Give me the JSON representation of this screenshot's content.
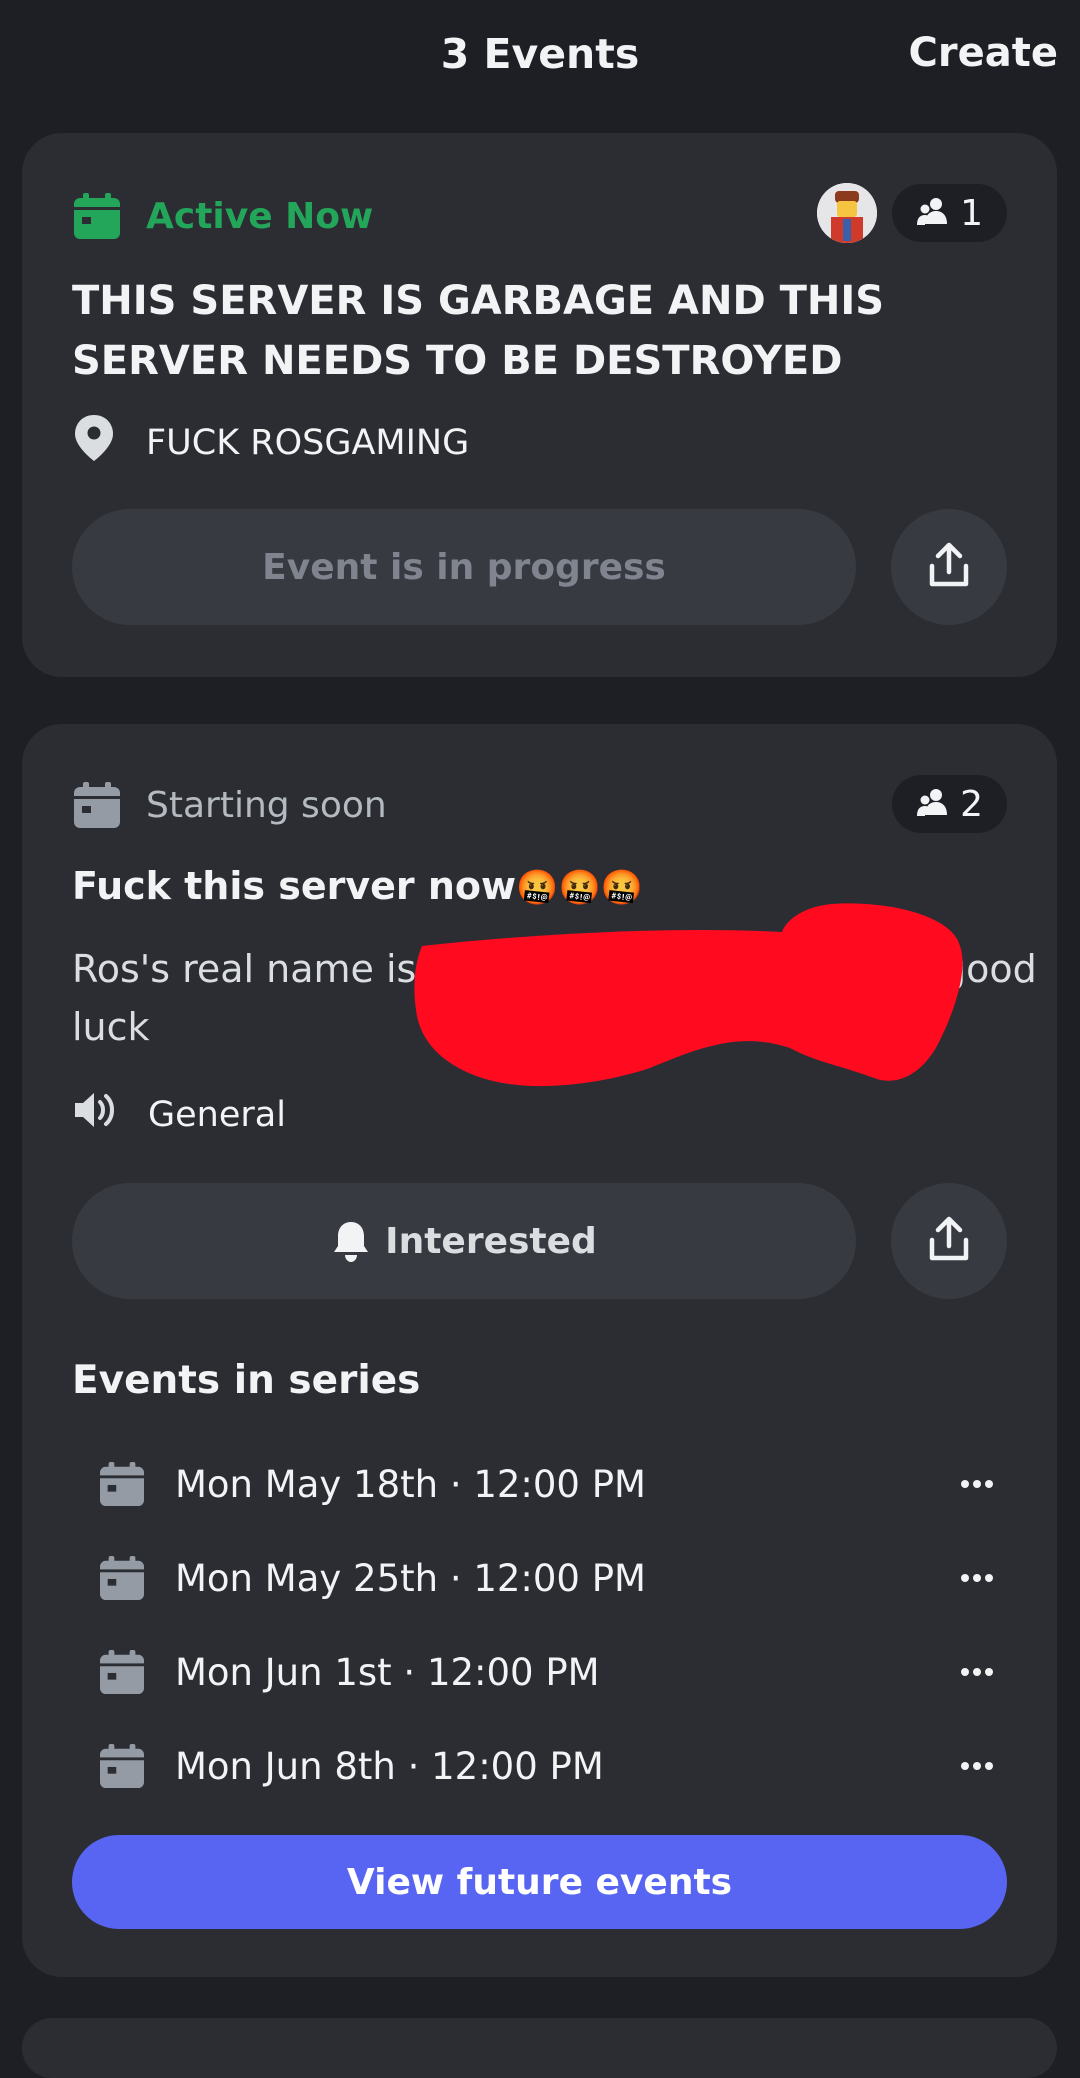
{
  "header": {
    "title": "3 Events",
    "create_label": "Create"
  },
  "events": [
    {
      "status": "Active Now",
      "status_color": "#23a55a",
      "interested_count": "1",
      "title": "THIS SERVER IS GARBAGE AND THIS SERVER NEEDS TO BE DESTROYED",
      "location_icon": "location-pin-icon",
      "location": "FUCK ROSGAMING",
      "action_label": "Event is in progress",
      "share_icon": "share-icon"
    },
    {
      "status": "Starting soon",
      "status_color": "#b5bac1",
      "interested_count": "2",
      "title": "Fuck this server now",
      "title_emoji": "🤬🤬🤬",
      "description_start": "Ros's real name is",
      "description_end": "good",
      "description_line2": "luck",
      "channel_icon": "speaker-icon",
      "channel": "General",
      "action_icon": "bell-icon",
      "action_label": "Interested",
      "share_icon": "share-icon",
      "series_heading": "Events in series",
      "series": [
        {
          "date": "Mon May 18th · 12:00 PM"
        },
        {
          "date": "Mon May 25th · 12:00 PM"
        },
        {
          "date": "Mon Jun 1st · 12:00 PM"
        },
        {
          "date": "Mon Jun 8th · 12:00 PM"
        }
      ],
      "primary_button": "View future events"
    }
  ],
  "colors": {
    "background": "#1e1f24",
    "card": "#2b2d33",
    "button": "#383a42",
    "accent": "#5865f2",
    "redaction": "#ff0a1f"
  }
}
